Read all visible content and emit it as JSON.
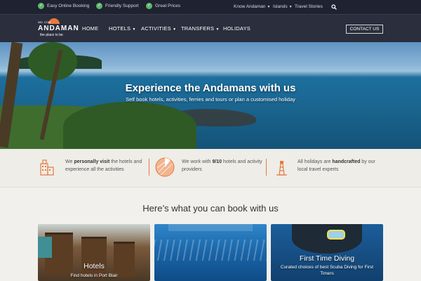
{
  "topbar": {
    "features": [
      "Easy Online Booking",
      "Friendly Support",
      "Great Prices"
    ],
    "links": [
      "Know Andaman",
      "Islands",
      "Travel Stories"
    ]
  },
  "header": {
    "logo_top": "082 .COM",
    "logo_brand": "ANDAMAN",
    "logo_tag": "the place to be",
    "nav": [
      "HOME",
      "HOTELS",
      "ACTIVITIES",
      "TRANSFERS",
      "HOLIDAYS"
    ],
    "contact": "CONTACT US"
  },
  "hero": {
    "title": "Experience the Andamans with us",
    "subtitle": "Self book hotels, activities, ferries and tours or plan a customised holiday"
  },
  "features": [
    {
      "pre": "We ",
      "bold": "personally visit",
      "post": " the hotels and experience all the activities"
    },
    {
      "pre": "We work with ",
      "bold": "9/10",
      "post": " hotels and activity providers"
    },
    {
      "pre": "All holidays are ",
      "bold": "handcrafted",
      "post": " by our local travel experts"
    }
  ],
  "section": {
    "title": "Here’s what you can book with us"
  },
  "cards": [
    {
      "title": "Hotels",
      "subtitle": "Find hotels in Port Blair"
    },
    {
      "title": "",
      "subtitle": ""
    },
    {
      "title": "First Time Diving",
      "subtitle": "Curated choices of best Scuba Diving for First Timers"
    }
  ],
  "colors": {
    "accent": "#e8793e",
    "topbar": "#1f2230",
    "header": "#2a2e3d",
    "check": "#5db86a"
  }
}
